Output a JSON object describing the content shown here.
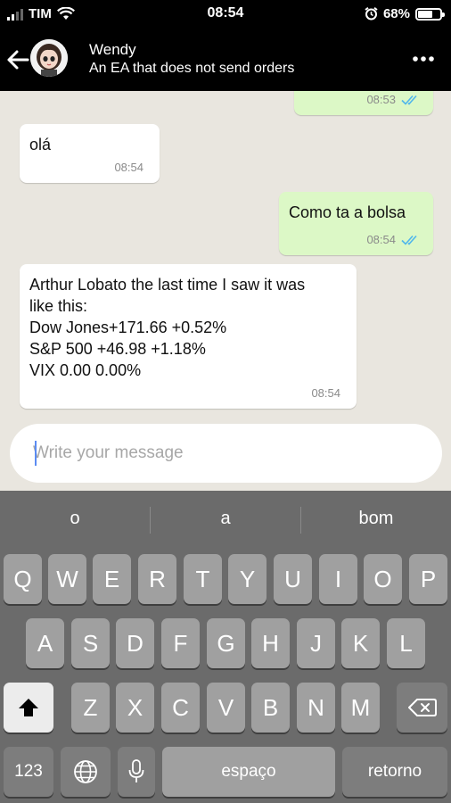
{
  "status_bar": {
    "carrier": "TIM",
    "time": "08:54",
    "battery_percent": "68%",
    "battery_level": 0.68,
    "icons": [
      "signal-icon",
      "wifi-icon",
      "alarm-icon",
      "battery-icon"
    ]
  },
  "header": {
    "contact_name": "Wendy",
    "contact_status": "An EA that does not send orders",
    "icons": [
      "back-arrow-icon",
      "avatar",
      "more-options-icon"
    ]
  },
  "messages": [
    {
      "direction": "out",
      "text": "",
      "time": "08:53",
      "read": true
    },
    {
      "direction": "in",
      "text": "olá",
      "time": "08:54"
    },
    {
      "direction": "out",
      "text": "Como ta a bolsa",
      "time": "08:54",
      "read": true
    },
    {
      "direction": "in",
      "text": "Arthur Lobato the last time I saw it was\nlike this:\nDow Jones+171.66 +0.52%\nS&P 500 +46.98 +1.18%\nVIX 0.00 0.00%",
      "time": "08:54"
    }
  ],
  "compose": {
    "placeholder": "Write your message",
    "value": ""
  },
  "keyboard": {
    "suggestions": [
      "o",
      "a",
      "bom"
    ],
    "row1": [
      "Q",
      "W",
      "E",
      "R",
      "T",
      "Y",
      "U",
      "I",
      "O",
      "P"
    ],
    "row2": [
      "A",
      "S",
      "D",
      "F",
      "G",
      "H",
      "J",
      "K",
      "L"
    ],
    "row3": [
      "Z",
      "X",
      "C",
      "V",
      "B",
      "N",
      "M"
    ],
    "numbers_label": "123",
    "space_label": "espaço",
    "return_label": "retorno",
    "icons": [
      "shift-icon",
      "backspace-icon",
      "globe-icon",
      "microphone-icon"
    ]
  },
  "colors": {
    "header_bg": "#000000",
    "chat_bg": "#e9e6df",
    "outgoing_bubble": "#dcf8c6",
    "incoming_bubble": "#ffffff",
    "read_ticks": "#4fb6ec",
    "keyboard_bg": "#6b6b6b"
  }
}
